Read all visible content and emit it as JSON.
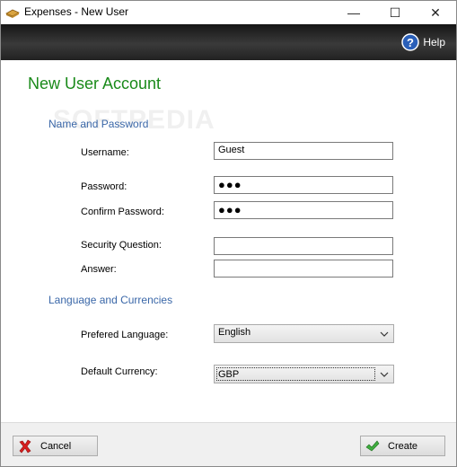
{
  "window": {
    "title": "Expenses - New User",
    "controls": {
      "minimize": "—",
      "maximize": "☐",
      "close": "✕"
    }
  },
  "toolbar": {
    "help_label": "Help"
  },
  "main": {
    "title": "New User Account",
    "watermark": "SOFTPEDIA",
    "section_name_password": "Name and Password",
    "username_label": "Username:",
    "username_value": "Guest",
    "password_label": "Password:",
    "password_value": "●●●",
    "confirm_label": "Confirm Password:",
    "confirm_value": "●●●",
    "question_label": "Security Question:",
    "question_value": "",
    "answer_label": "Answer:",
    "answer_value": "",
    "section_language": "Language and Currencies",
    "language_label": "Prefered Language:",
    "language_value": "English",
    "currency_label": "Default Currency:",
    "currency_value": "GBP"
  },
  "buttons": {
    "cancel": "Cancel",
    "create": "Create"
  },
  "colors": {
    "title_green": "#1a8a1a",
    "section_blue": "#3a67a8",
    "toolbar_dark": "#222222"
  },
  "icons": {
    "app": "book-icon",
    "help": "question-circle-icon",
    "cancel": "red-x-icon",
    "create": "green-check-icon",
    "dropdown": "chevron-down-icon"
  }
}
